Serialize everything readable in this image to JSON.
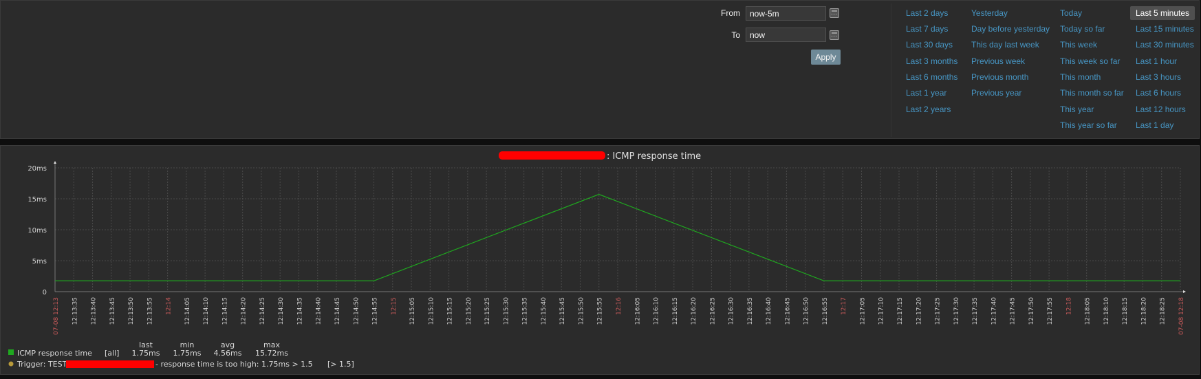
{
  "filter": {
    "from_label": "From",
    "from_value": "now-5m",
    "to_label": "To",
    "to_value": "now",
    "apply_label": "Apply",
    "quick_ranges": [
      [
        "Last 2 days",
        "Last 7 days",
        "Last 30 days",
        "Last 3 months",
        "Last 6 months",
        "Last 1 year",
        "Last 2 years"
      ],
      [
        "Yesterday",
        "Day before yesterday",
        "This day last week",
        "Previous week",
        "Previous month",
        "Previous year"
      ],
      [
        "Today",
        "Today so far",
        "This week",
        "This week so far",
        "This month",
        "This month so far",
        "This year",
        "This year so far"
      ],
      [
        "Last 5 minutes",
        "Last 15 minutes",
        "Last 30 minutes",
        "Last 1 hour",
        "Last 3 hours",
        "Last 6 hours",
        "Last 12 hours",
        "Last 1 day"
      ]
    ],
    "selected": "Last 5 minutes"
  },
  "chart_data": {
    "type": "line",
    "title": ": ICMP response time",
    "xlim": [
      "12:13:30",
      "12:18:30"
    ],
    "ylim": [
      0,
      20
    ],
    "y_ticks": [
      "0",
      "5ms",
      "10ms",
      "15ms",
      "20ms"
    ],
    "start_label": "07-08 12:13",
    "end_label": "07-08 12:18",
    "grid": true,
    "series": [
      {
        "name": "ICMP response time",
        "color": "#1fa81f",
        "x": [
          "12:13:30",
          "12:14:55",
          "12:15:55",
          "12:16:55",
          "12:18:30"
        ],
        "y": [
          1.75,
          1.75,
          15.72,
          1.75,
          1.75
        ]
      }
    ],
    "colors": {
      "minute_label": "#c85a5a",
      "tick_label": "#d0d0d0",
      "grid": "#4a4a4a"
    }
  },
  "legend": {
    "headers": [
      "last",
      "min",
      "avg",
      "max"
    ],
    "item": {
      "name": "ICMP response time",
      "func": "[all]",
      "last": "1.75ms",
      "min": "1.75ms",
      "avg": "4.56ms",
      "max": "15.72ms",
      "color": "#1fa81f"
    },
    "trigger": {
      "prefix": "Trigger: TEST",
      "text": " - response time is too high: 1.75ms > 1.5",
      "threshold": "[> 1.5]",
      "color": "#b89a3a"
    }
  }
}
